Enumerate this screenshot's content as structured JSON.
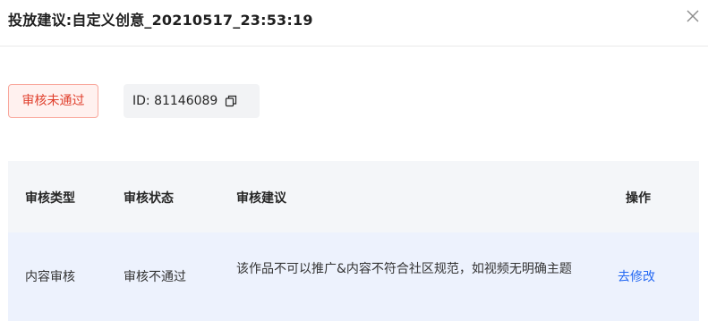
{
  "dialog": {
    "title": "投放建议:自定义创意_20210517_23:53:19",
    "close_icon": "close-icon"
  },
  "status": {
    "label": "审核未通过",
    "color": "#e0402d"
  },
  "id_tag": {
    "text": "ID: 81146089",
    "copy_icon": "copy-icon"
  },
  "table": {
    "headers": [
      "审核类型",
      "审核状态",
      "审核建议",
      "操作"
    ],
    "rows": [
      {
        "type": "内容审核",
        "status": "审核不通过",
        "suggestion": "该作品不可以推广&内容不符合社区规范，如视频无明确主题",
        "action": "去修改"
      }
    ]
  },
  "colors": {
    "accent": "#2468f2",
    "error": "#e0402d",
    "header_bg": "#f4f6f9",
    "row_bg": "#edf2fd"
  }
}
